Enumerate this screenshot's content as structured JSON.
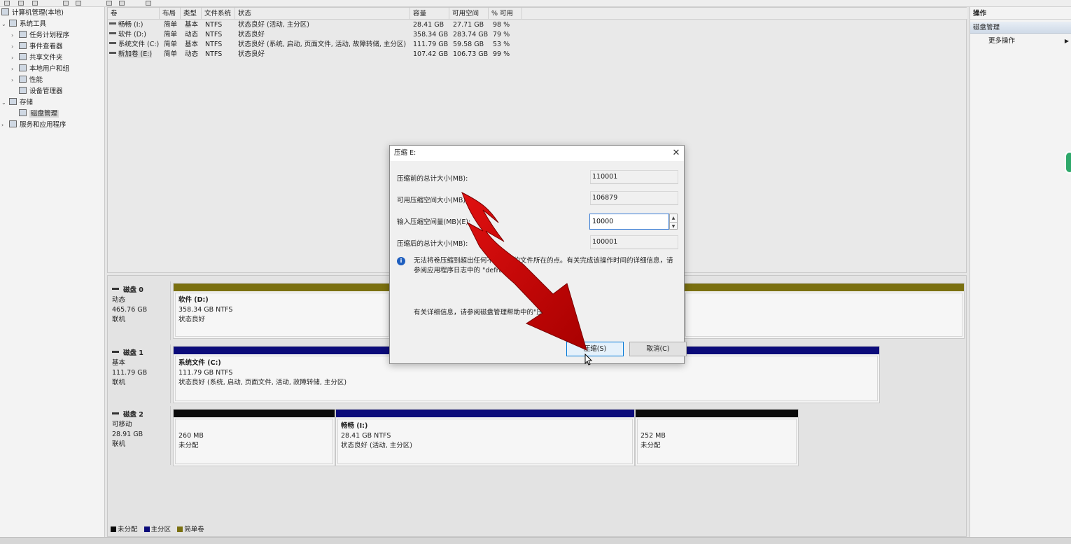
{
  "tree": {
    "root": "计算机管理(本地)",
    "items": [
      {
        "label": "系统工具",
        "icon": "tools-icon",
        "arrow": "⌄"
      },
      {
        "label": "任务计划程序",
        "icon": "clock-icon",
        "arrow": "›"
      },
      {
        "label": "事件查看器",
        "icon": "event-viewer-icon",
        "arrow": "›"
      },
      {
        "label": "共享文件夹",
        "icon": "shared-folder-icon",
        "arrow": "›"
      },
      {
        "label": "本地用户和组",
        "icon": "users-icon",
        "arrow": "›"
      },
      {
        "label": "性能",
        "icon": "performance-icon",
        "arrow": "›"
      },
      {
        "label": "设备管理器",
        "icon": "device-manager-icon",
        "arrow": ""
      },
      {
        "label": "存储",
        "icon": "storage-icon",
        "arrow": "⌄"
      },
      {
        "label": "磁盘管理",
        "icon": "disk-management-icon",
        "arrow": ""
      },
      {
        "label": "服务和应用程序",
        "icon": "services-icon",
        "arrow": "›"
      }
    ]
  },
  "volume_list": {
    "columns": [
      "卷",
      "布局",
      "类型",
      "文件系统",
      "状态",
      "容量",
      "可用空间",
      "% 可用"
    ],
    "rows": [
      {
        "name": "畅畅 (I:)",
        "layout": "简单",
        "type": "基本",
        "fs": "NTFS",
        "status": "状态良好 (活动, 主分区)",
        "capacity": "28.41 GB",
        "free": "27.71 GB",
        "pct": "98 %"
      },
      {
        "name": "软件 (D:)",
        "layout": "简单",
        "type": "动态",
        "fs": "NTFS",
        "status": "状态良好",
        "capacity": "358.34 GB",
        "free": "283.74 GB",
        "pct": "79 %"
      },
      {
        "name": "系统文件 (C:)",
        "layout": "简单",
        "type": "基本",
        "fs": "NTFS",
        "status": "状态良好 (系统, 启动, 页面文件, 活动, 故障转储, 主分区)",
        "capacity": "111.79 GB",
        "free": "59.58 GB",
        "pct": "53 %"
      },
      {
        "name": "新加卷 (E:)",
        "layout": "简单",
        "type": "动态",
        "fs": "NTFS",
        "status": "状态良好",
        "capacity": "107.42 GB",
        "free": "106.73 GB",
        "pct": "99 %"
      }
    ]
  },
  "disks": [
    {
      "name": "磁盘 0",
      "kind": "动态",
      "size": "465.76 GB",
      "state": "联机",
      "partitions": [
        {
          "name": "软件 (D:)",
          "size": "358.34 GB NTFS",
          "status": "状态良好",
          "bar_color": "#7a7010"
        },
        {
          "name": "",
          "size": "",
          "status": "",
          "bar_color": "#7a7010"
        }
      ]
    },
    {
      "name": "磁盘 1",
      "kind": "基本",
      "size": "111.79 GB",
      "state": "联机",
      "partitions": [
        {
          "name": "系统文件 (C:)",
          "size": "111.79 GB NTFS",
          "status": "状态良好 (系统, 启动, 页面文件, 活动, 故障转储, 主分区)",
          "bar_color": "#0b0b7a"
        }
      ]
    },
    {
      "name": "磁盘 2",
      "kind": "可移动",
      "size": "28.91 GB",
      "state": "联机",
      "partitions": [
        {
          "name": "",
          "size": "260 MB",
          "status": "未分配",
          "bar_color": "#0a0a0a"
        },
        {
          "name": "畅畅 (I:)",
          "size": "28.41 GB NTFS",
          "status": "状态良好 (活动, 主分区)",
          "bar_color": "#0b0b7a"
        },
        {
          "name": "",
          "size": "252 MB",
          "status": "未分配",
          "bar_color": "#0a0a0a"
        }
      ]
    }
  ],
  "legend": [
    {
      "label": "未分配",
      "color": "#0a0a0a"
    },
    {
      "label": "主分区",
      "color": "#0b0b7a"
    },
    {
      "label": "简单卷",
      "color": "#7a7010"
    }
  ],
  "actions": {
    "title": "操作",
    "section": "磁盘管理",
    "more": "更多操作"
  },
  "dialog": {
    "title": "压缩 E:",
    "close": "✕",
    "fields": [
      {
        "label": "压缩前的总计大小(MB):",
        "value": "110001"
      },
      {
        "label": "可用压缩空间大小(MB):",
        "value": "106879"
      },
      {
        "label": "输入压缩空间量(MB)(E):",
        "value": "10000"
      },
      {
        "label": "压缩后的总计大小(MB):",
        "value": "100001"
      }
    ],
    "info_text": "无法将卷压缩到超出任何不可移动的文件所在的点。有关完成该操作时间的详细信息，请参阅应用程序日志中的 \"defrag\" 事件。",
    "help_text": "有关详细信息，请参阅磁盘管理帮助中的\"压缩基本卷\"。",
    "ok_button": "压缩(S)",
    "cancel_button": "取消(C)"
  },
  "colors": {
    "arrow": "#c40000",
    "dialog_accent": "#0078d7"
  }
}
